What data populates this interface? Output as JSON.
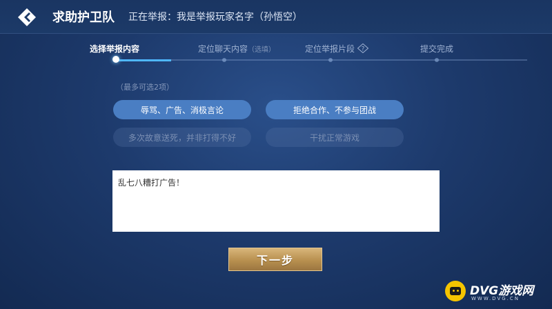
{
  "header": {
    "title": "求助护卫队",
    "reporting_text": "正在举报：我是举报玩家名字（孙悟空）"
  },
  "steps": [
    {
      "label": "选择举报内容",
      "optional": "",
      "active": true
    },
    {
      "label": "定位聊天内容",
      "optional": "（选填）",
      "active": false
    },
    {
      "label": "定位举报片段",
      "optional": "",
      "active": false
    },
    {
      "label": "提交完成",
      "optional": "",
      "active": false
    }
  ],
  "hint": "（最多可选2项）",
  "options": [
    {
      "label": "辱骂、广告、消极言论",
      "state": "selected"
    },
    {
      "label": "拒绝合作、不参与团战",
      "state": "selected"
    },
    {
      "label": "多次故意送死，并非打得不好",
      "state": "disabled"
    },
    {
      "label": "干扰正常游戏",
      "state": "disabled"
    }
  ],
  "textbox": {
    "value": "乱七八糟打广告！"
  },
  "next_button": "下一步",
  "watermark": {
    "text": "DVG游戏网",
    "sub": "WWW.DVG.CN"
  },
  "colors": {
    "accent": "#4fb7ff",
    "selected_option": "#4a7ec3",
    "button_gold": "#c9a262"
  }
}
